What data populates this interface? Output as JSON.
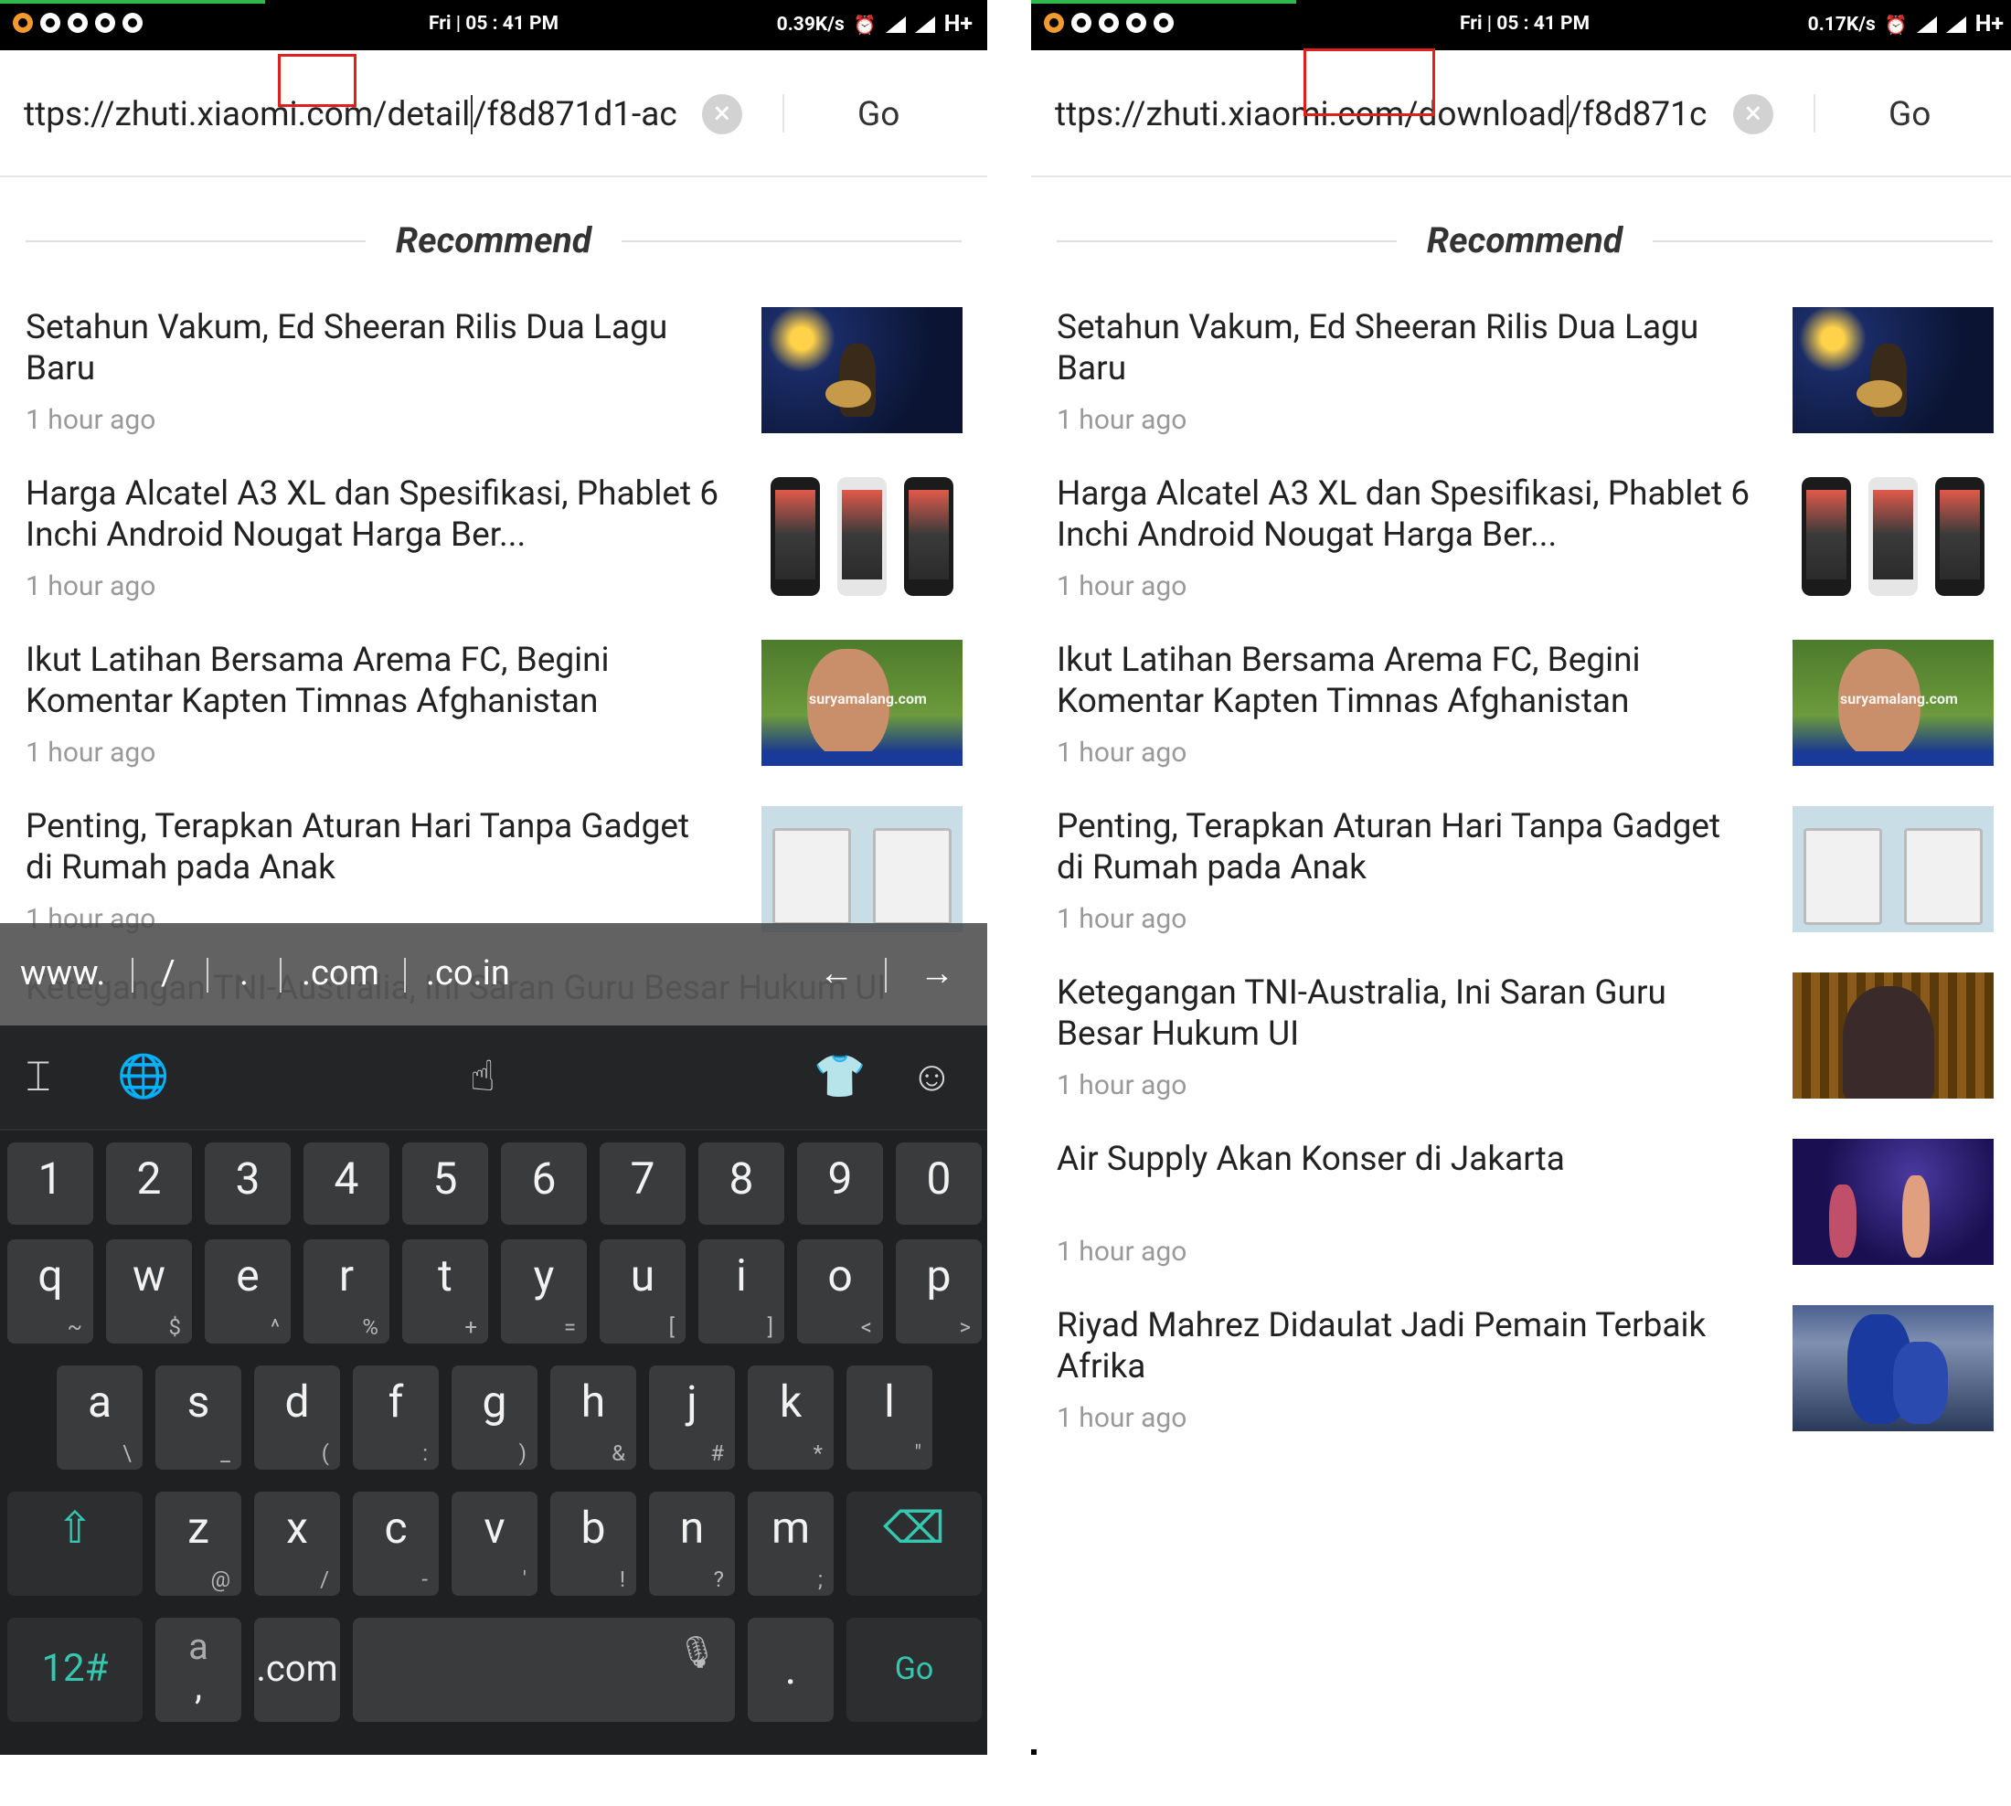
{
  "panels": [
    {
      "status": {
        "time": "Fri | 05 : 41 PM",
        "speed": "0.39K/s",
        "network": "H+"
      },
      "url": {
        "before": "ttps://zhuti.xiaomi.com",
        "highlight": "/detail",
        "after": "/f8d871d1-ac",
        "go": "Go"
      },
      "recommend_title": "Recommend"
    },
    {
      "status": {
        "time": "Fri | 05 : 41 PM",
        "speed": "0.17K/s",
        "network": "H+"
      },
      "url": {
        "before": "ttps://zhuti.xiaomi.com",
        "highlight": "/download",
        "after": "/f8d871c",
        "go": "Go"
      },
      "recommend_title": "Recommend"
    }
  ],
  "news": [
    {
      "title": "Setahun Vakum, Ed Sheeran Rilis Dua Lagu Baru",
      "time": "1 hour ago",
      "thumb": "concert"
    },
    {
      "title": "Harga Alcatel A3 XL dan Spesifikasi, Phablet 6 Inchi Android Nougat Harga Ber...",
      "time": "1 hour ago",
      "thumb": "phones"
    },
    {
      "title": "Ikut Latihan Bersama Arema FC, Begini Komentar Kapten Timnas Afghanistan",
      "time": "1 hour ago",
      "thumb": "soccer",
      "watermark": "suryamalang.com"
    },
    {
      "title": "Penting, Terapkan Aturan Hari Tanpa Gadget di Rumah pada Anak",
      "time": "1 hour ago",
      "thumb": "kids"
    },
    {
      "title": "Ketegangan TNI-Australia, Ini Saran Guru Besar Hukum UI",
      "time": "1 hour ago",
      "thumb": "speaker"
    },
    {
      "title": "Air Supply Akan Konser di Jakarta",
      "time": "1 hour ago",
      "thumb": "band"
    },
    {
      "title": "Riyad Mahrez Didaulat Jadi Pemain Terbaik Afrika",
      "time": "1 hour ago",
      "thumb": "football"
    }
  ],
  "keyboard": {
    "suggestions": [
      "www.",
      "/",
      ".",
      ".com",
      ".co.in"
    ],
    "arrows": [
      "←",
      "→"
    ],
    "row_numbers": [
      "1",
      "2",
      "3",
      "4",
      "5",
      "6",
      "7",
      "8",
      "9",
      "0"
    ],
    "row_q": [
      [
        "q",
        "~"
      ],
      [
        "w",
        "$"
      ],
      [
        "e",
        "^"
      ],
      [
        "r",
        "%"
      ],
      [
        "t",
        "+"
      ],
      [
        "y",
        "="
      ],
      [
        "u",
        "["
      ],
      [
        "i",
        "]"
      ],
      [
        "o",
        "<"
      ],
      [
        "p",
        ">"
      ]
    ],
    "row_a": [
      [
        "a",
        "\\"
      ],
      [
        "s",
        "_"
      ],
      [
        "d",
        "("
      ],
      [
        "f",
        ":"
      ],
      [
        "g",
        ")"
      ],
      [
        "h",
        "&"
      ],
      [
        "j",
        "#"
      ],
      [
        "k",
        "*"
      ],
      [
        "l",
        "\""
      ]
    ],
    "row_z": [
      [
        "z",
        "@"
      ],
      [
        "x",
        "/"
      ],
      [
        "c",
        "-"
      ],
      [
        "v",
        "'"
      ],
      [
        "b",
        "!"
      ],
      [
        "n",
        "?"
      ],
      [
        "m",
        ";"
      ]
    ],
    "bottom": {
      "sym": "12#",
      "lang_top": "a",
      "lang_bottom": ",",
      "dotcom": ".com",
      "period": ".",
      "go": "Go"
    },
    "accent": "#35c7b0"
  }
}
